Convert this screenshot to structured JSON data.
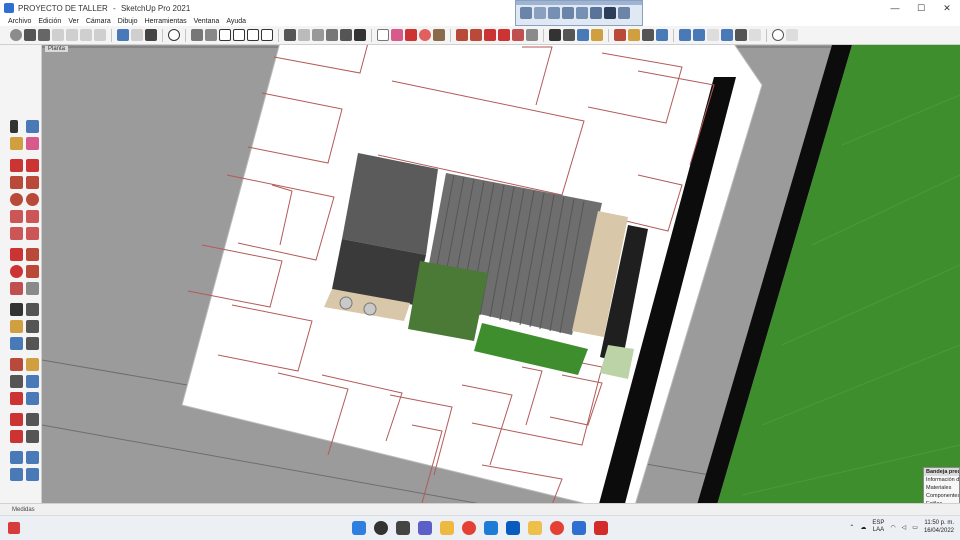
{
  "window": {
    "title_document": "PROYECTO DE TALLER",
    "title_separator": "-",
    "title_app": "SketchUp Pro 2021",
    "controls": [
      "—",
      "☐",
      "✕"
    ]
  },
  "menu": [
    "Archivo",
    "Edición",
    "Ver",
    "Cámara",
    "Dibujo",
    "Herramientas",
    "Ventana",
    "Ayuda"
  ],
  "viewport": {
    "scene_tab": "Planta",
    "colors": {
      "background": "#9b9b9b",
      "site": "#ffffff",
      "walls": "#b35a5a",
      "road": "#0c0c0c",
      "grass": "#3f8e2e",
      "roof_dark": "#5b5b5b",
      "roof_ribbed": "#6e6e6e",
      "wood": "#d8c7a8",
      "garden": "#4a7a35"
    }
  },
  "tray": {
    "title": "Bandeja predeterminada",
    "items": [
      "Información de la entidad",
      "Materiales",
      "Componentes",
      "Estilos"
    ]
  },
  "status": {
    "text": "Medidas"
  },
  "taskbar": {
    "lang_line1": "ESP",
    "lang_line2": "LAA",
    "time": "11:50 p. m.",
    "date": "16/04/2022"
  }
}
